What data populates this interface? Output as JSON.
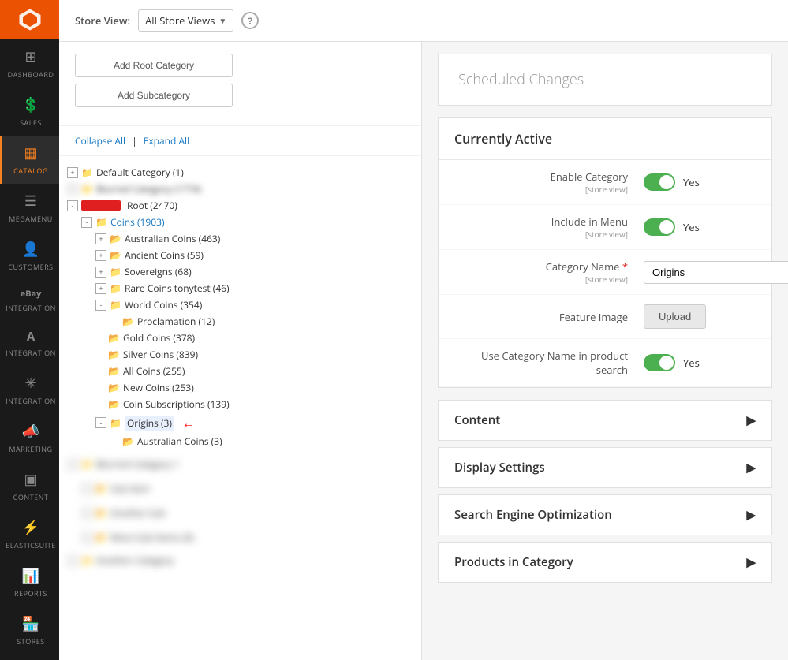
{
  "sidebar": {
    "logo_alt": "Magento Logo",
    "items": [
      {
        "id": "dashboard",
        "label": "DASHBOARD",
        "icon": "⊞"
      },
      {
        "id": "sales",
        "label": "SALES",
        "icon": "$"
      },
      {
        "id": "catalog",
        "label": "CATALOG",
        "icon": "▦",
        "active": true
      },
      {
        "id": "megamenu",
        "label": "MEGAMENU",
        "icon": "☰"
      },
      {
        "id": "customers",
        "label": "CUSTOMERS",
        "icon": "👤"
      },
      {
        "id": "ebay-integration",
        "label": "INTEGRATION",
        "icon": "eBay"
      },
      {
        "id": "amazon-integration",
        "label": "INTEGRATION",
        "icon": "A"
      },
      {
        "id": "integration",
        "label": "INTEGRATION",
        "icon": "✳"
      },
      {
        "id": "marketing",
        "label": "MARKETING",
        "icon": "✦"
      },
      {
        "id": "content",
        "label": "CONTENT",
        "icon": "▣"
      },
      {
        "id": "elasticsuite",
        "label": "ELASTICSUITE",
        "icon": "⚡"
      },
      {
        "id": "reports",
        "label": "REPORTS",
        "icon": "📊"
      },
      {
        "id": "stores",
        "label": "STORES",
        "icon": "🏪"
      }
    ]
  },
  "topbar": {
    "store_view_label": "Store View:",
    "store_view_value": "All Store Views",
    "help_tooltip": "Help"
  },
  "left_panel": {
    "add_root_category_label": "Add Root Category",
    "add_subcategory_label": "Add Subcategory",
    "collapse_all_label": "Collapse All",
    "expand_all_label": "Expand All",
    "tree": [
      {
        "id": "default",
        "label": "Default Category (1)",
        "level": 0,
        "expanded": true
      },
      {
        "id": "blurred1",
        "label": "Blurred Category (1774)",
        "level": 0,
        "blurred": true
      },
      {
        "id": "root",
        "label": "Root (2470)",
        "level": 0,
        "expanded": true,
        "redacted": true
      },
      {
        "id": "coins",
        "label": "Coins (1903)",
        "level": 1,
        "expanded": true
      },
      {
        "id": "australian-coins",
        "label": "Australian Coins (463)",
        "level": 2
      },
      {
        "id": "ancient-coins",
        "label": "Ancient Coins (59)",
        "level": 2
      },
      {
        "id": "sovereigns",
        "label": "Sovereigns (68)",
        "level": 2
      },
      {
        "id": "rare-coins",
        "label": "Rare Coins tonytest (46)",
        "level": 2
      },
      {
        "id": "world-coins",
        "label": "World Coins (354)",
        "level": 2,
        "expanded": true
      },
      {
        "id": "proclamation",
        "label": "Proclamation (12)",
        "level": 3
      },
      {
        "id": "gold-coins",
        "label": "Gold Coins (378)",
        "level": 2
      },
      {
        "id": "silver-coins",
        "label": "Silver Coins (839)",
        "level": 2
      },
      {
        "id": "all-coins",
        "label": "All Coins (255)",
        "level": 2
      },
      {
        "id": "new-coins",
        "label": "New Coins (253)",
        "level": 2
      },
      {
        "id": "coin-subscriptions",
        "label": "Coin Subscriptions (139)",
        "level": 2
      },
      {
        "id": "origins",
        "label": "Origins (3)",
        "level": 2,
        "selected": true,
        "expanded": true
      },
      {
        "id": "australian-coins-origins",
        "label": "Australian Coins (3)",
        "level": 3
      }
    ]
  },
  "right_panel": {
    "scheduled_changes_title": "Scheduled Changes",
    "currently_active_title": "Currently Active",
    "fields": {
      "enable_category_label": "Enable Category",
      "enable_category_sub": "[store view]",
      "enable_category_value": "Yes",
      "include_in_menu_label": "Include in Menu",
      "include_in_menu_sub": "[store view]",
      "include_in_menu_value": "Yes",
      "category_name_label": "Category Name",
      "category_name_sub": "[store view]",
      "category_name_required": "*",
      "category_name_value": "Origins",
      "feature_image_label": "Feature Image",
      "upload_label": "Upload",
      "use_category_name_label": "Use Category Name in product search",
      "use_category_name_value": "Yes"
    },
    "sections": [
      {
        "id": "content",
        "label": "Content"
      },
      {
        "id": "display-settings",
        "label": "Display Settings"
      },
      {
        "id": "seo",
        "label": "Search Engine Optimization"
      },
      {
        "id": "products-in-category",
        "label": "Products in Category"
      }
    ]
  }
}
